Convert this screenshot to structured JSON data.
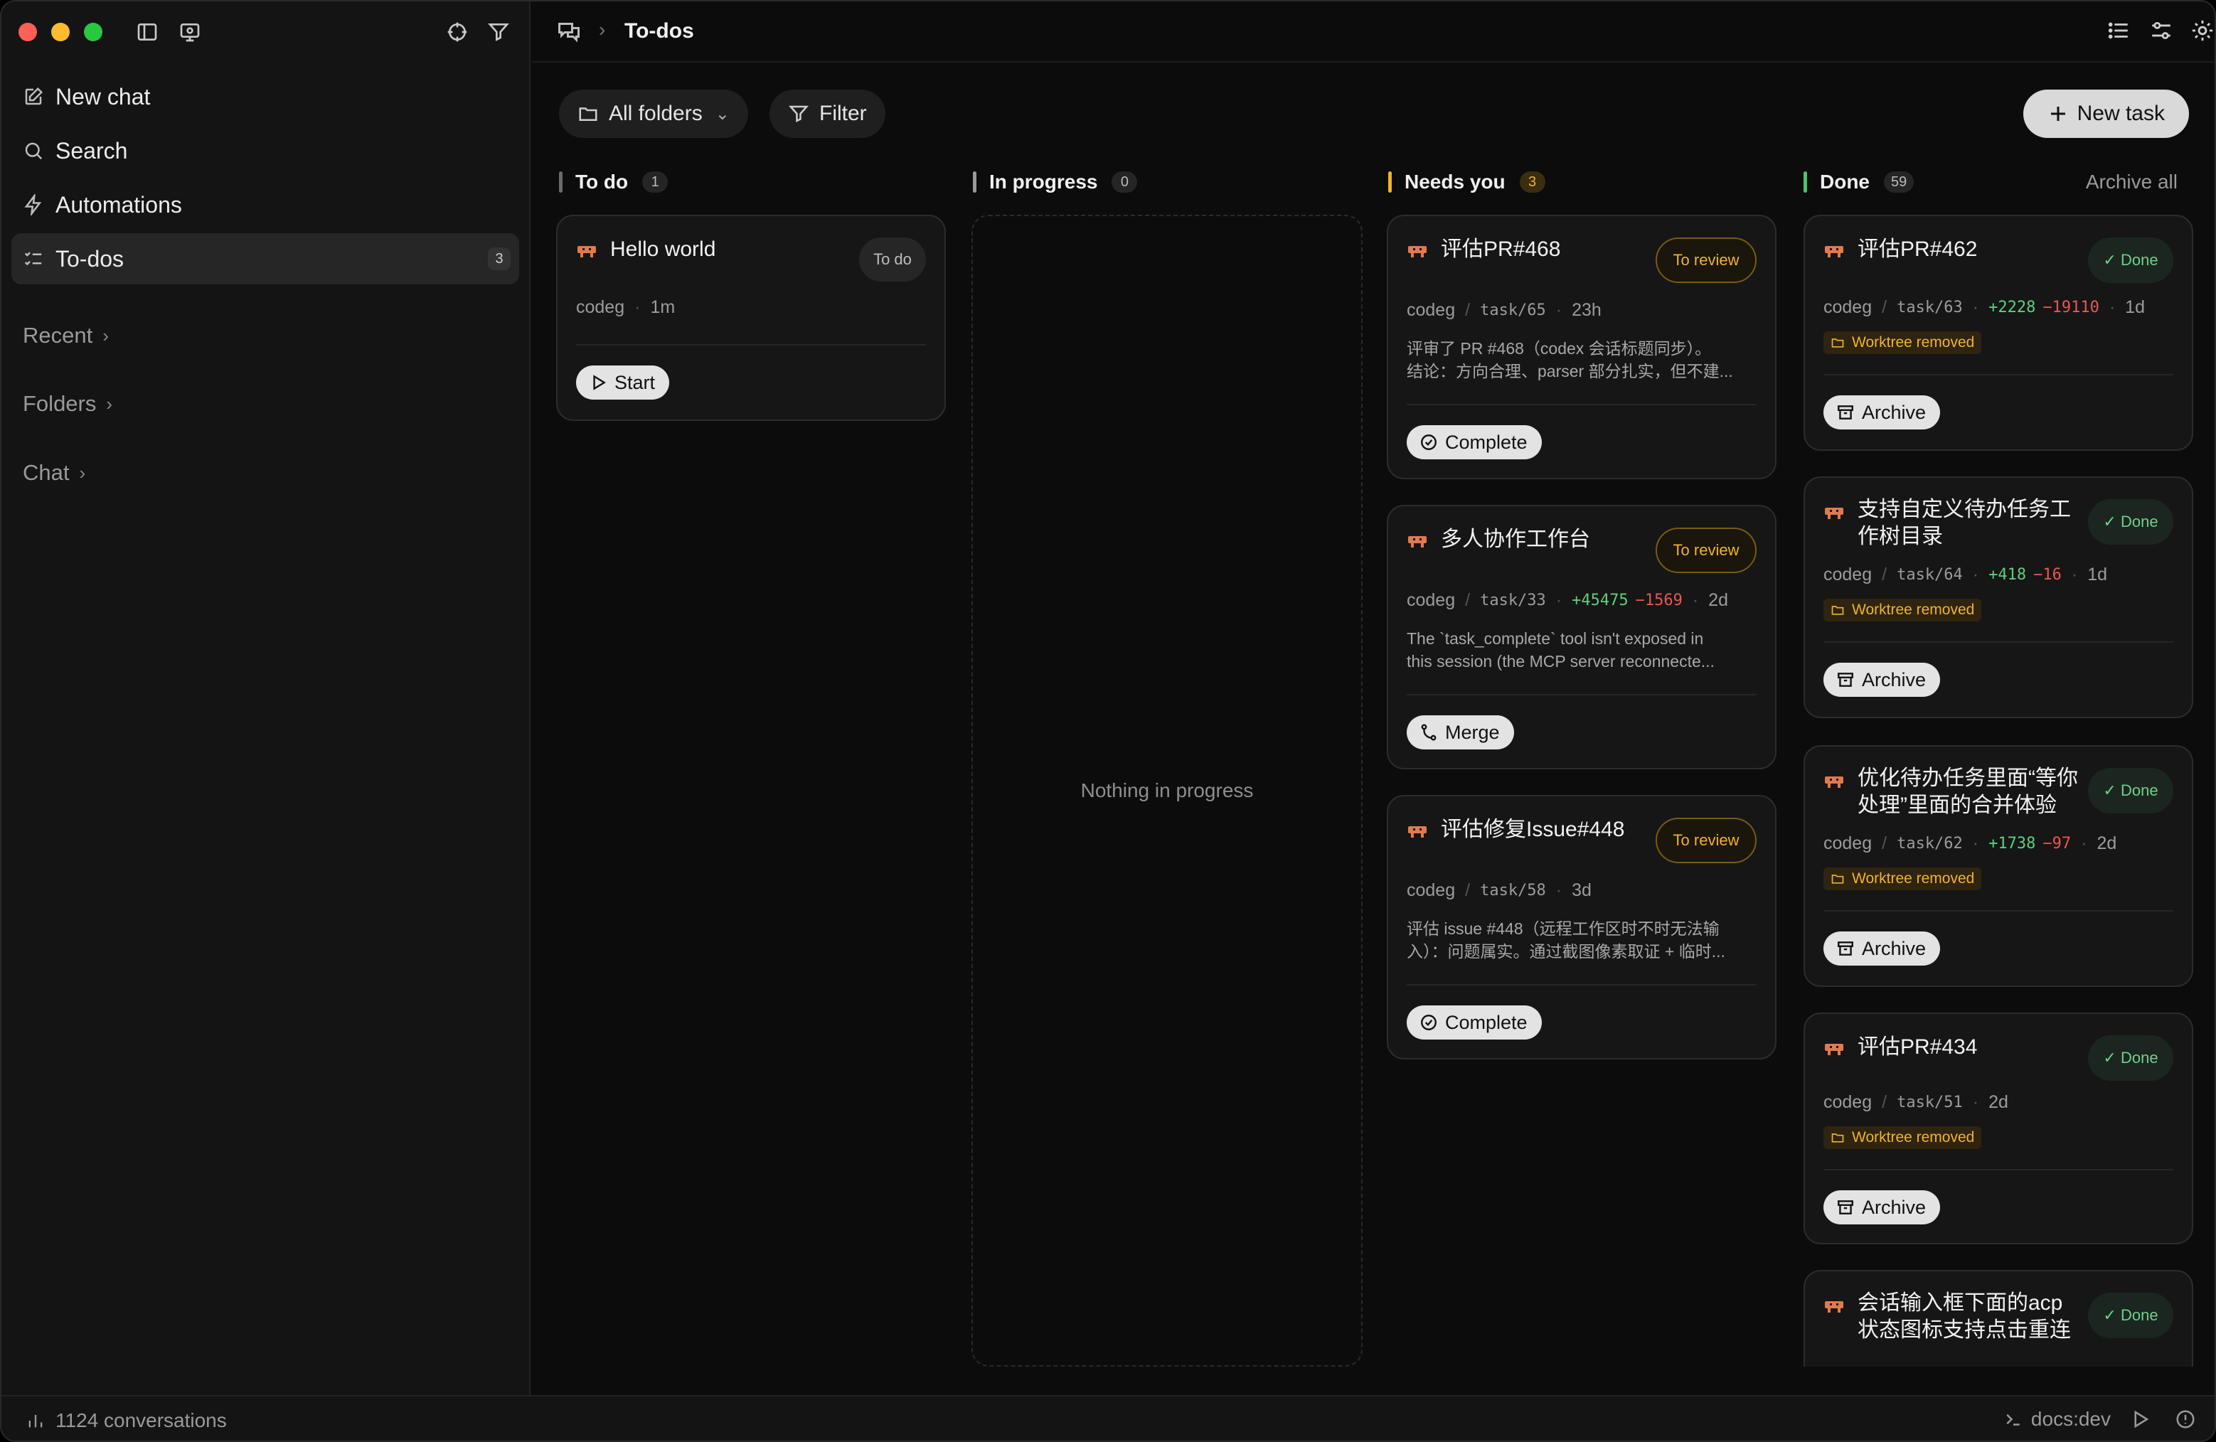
{
  "sidebar": {
    "nav": [
      {
        "label": "New chat",
        "icon": "compose-icon"
      },
      {
        "label": "Search",
        "icon": "search-icon"
      },
      {
        "label": "Automations",
        "icon": "bolt-icon"
      },
      {
        "label": "To-dos",
        "icon": "checklist-icon",
        "count": "3",
        "active": true
      }
    ],
    "sections": [
      "Recent",
      "Folders",
      "Chat"
    ]
  },
  "topbar": {
    "title": "To-dos"
  },
  "toolbar": {
    "folders_label": "All folders",
    "filter_label": "Filter",
    "new_task_label": "New task"
  },
  "columns": {
    "todo": {
      "label": "To do",
      "count": "1",
      "color": "#6b6b6b"
    },
    "progress": {
      "label": "In progress",
      "count": "0",
      "color": "#9a9a9a",
      "empty": "Nothing in progress"
    },
    "needs": {
      "label": "Needs you",
      "count": "3",
      "color": "#f2b32a"
    },
    "done": {
      "label": "Done",
      "count": "59",
      "color": "#4ec36a",
      "archive_all": "Archive all"
    }
  },
  "cards": {
    "todo": [
      {
        "title": "Hello world",
        "status": "To do",
        "folder": "codeg",
        "time": "1m",
        "action": "Start"
      }
    ],
    "needs": [
      {
        "title": "评估PR#468",
        "status": "To review",
        "folder": "codeg",
        "task": "task/65",
        "time": "23h",
        "desc1": "评审了 PR #468（codex 会话标题同步）。",
        "desc2": "结论：方向合理、parser 部分扎实，但不建...",
        "action": "Complete"
      },
      {
        "title": "多人协作工作台",
        "status": "To review",
        "folder": "codeg",
        "task": "task/33",
        "add": "+45475",
        "del": "−1569",
        "time": "2d",
        "desc1": "The `task_complete` tool isn't exposed in",
        "desc2": "this session (the MCP server reconnecte...",
        "action": "Merge"
      },
      {
        "title": "评估修复Issue#448",
        "status": "To review",
        "folder": "codeg",
        "task": "task/58",
        "time": "3d",
        "desc1": "评估 issue #448（远程工作区时不时无法输",
        "desc2": "入）：问题属实。通过截图像素取证 + 临时...",
        "action": "Complete"
      }
    ],
    "done": [
      {
        "title1": "评估PR#462",
        "title2": "",
        "status": "Done",
        "folder": "codeg",
        "task": "task/63",
        "add": "+2228",
        "del": "−19110",
        "time": "1d",
        "badge": "Worktree removed",
        "action": "Archive"
      },
      {
        "title1": "支持自定义待办任务工",
        "title2": "作树目录",
        "status": "Done",
        "folder": "codeg",
        "task": "task/64",
        "add": "+418",
        "del": "−16",
        "time": "1d",
        "badge": "Worktree removed",
        "action": "Archive"
      },
      {
        "title1": "优化待办任务里面“等你",
        "title2": "处理”里面的合并体验",
        "status": "Done",
        "folder": "codeg",
        "task": "task/62",
        "add": "+1738",
        "del": "−97",
        "time": "2d",
        "badge": "Worktree removed",
        "action": "Archive"
      },
      {
        "title1": "评估PR#434",
        "title2": "",
        "status": "Done",
        "folder": "codeg",
        "task": "task/51",
        "time": "2d",
        "badge": "Worktree removed",
        "action": "Archive"
      },
      {
        "title1": "会话输入框下面的acp",
        "title2": "状态图标支持点击重连",
        "status": "Done"
      }
    ]
  },
  "statusbar": {
    "conversations": "1124 conversations",
    "env": "docs:dev"
  }
}
